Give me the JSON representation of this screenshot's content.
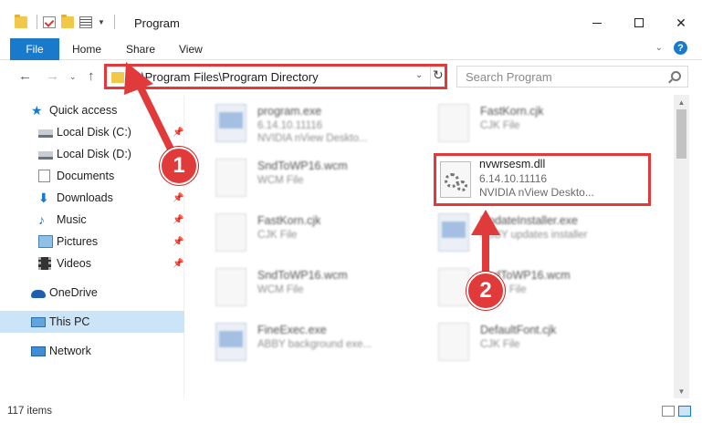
{
  "window": {
    "title": "Program"
  },
  "ribbon": {
    "tabs": [
      "File",
      "Home",
      "Share",
      "View"
    ]
  },
  "address": {
    "path": "C:\\Program Files\\Program Directory"
  },
  "search": {
    "placeholder": "Search Program"
  },
  "sidebar": {
    "items": [
      {
        "label": "Quick access",
        "icon": "star-icon"
      },
      {
        "label": "Local Disk (C:)",
        "icon": "drive-icon",
        "pinned": true
      },
      {
        "label": "Local Disk (D:)",
        "icon": "drive-icon"
      },
      {
        "label": "Documents",
        "icon": "documents-icon",
        "pinned": true
      },
      {
        "label": "Downloads",
        "icon": "download-icon",
        "pinned": true
      },
      {
        "label": "Music",
        "icon": "music-icon",
        "pinned": true
      },
      {
        "label": "Pictures",
        "icon": "pictures-icon",
        "pinned": true
      },
      {
        "label": "Videos",
        "icon": "videos-icon",
        "pinned": true
      },
      {
        "label": "OneDrive",
        "icon": "onedrive-icon"
      },
      {
        "label": "This PC",
        "icon": "pc-icon",
        "selected": true
      },
      {
        "label": "Network",
        "icon": "network-icon"
      }
    ]
  },
  "files": [
    {
      "name": "program.exe",
      "line2": "6.14.10.11116",
      "line3": "NVIDIA nView Deskto...",
      "icon": "exe"
    },
    {
      "name": "FastKorn.cjk",
      "line2": "CJK File",
      "line3": "",
      "icon": "file"
    },
    {
      "name": "SndToWP16.wcm",
      "line2": "WCM File",
      "line3": "",
      "icon": "file"
    },
    {
      "name": "FastKorn.cjk",
      "line2": "CJK File",
      "line3": "",
      "icon": "file"
    },
    {
      "name": "UpdateInstaller.exe",
      "line2": "ABBY updates installer",
      "line3": "",
      "icon": "exe"
    },
    {
      "name": "SndToWP16.wcm",
      "line2": "WCM File",
      "line3": "",
      "icon": "file"
    },
    {
      "name": "SndToWP16.wcm",
      "line2": "WCM File",
      "line3": "",
      "icon": "file"
    },
    {
      "name": "FineExec.exe",
      "line2": "ABBY background exe...",
      "line3": "",
      "icon": "exe"
    },
    {
      "name": "DefaultFont.cjk",
      "line2": "CJK File",
      "line3": "",
      "icon": "file"
    }
  ],
  "highlighted_file": {
    "name": "nvwrsesm.dll",
    "version": "6.14.10.11116",
    "description": "NVIDIA nView Deskto..."
  },
  "status": {
    "item_count": "117 items"
  },
  "annotations": {
    "badge1": "1",
    "badge2": "2",
    "color": "#e03a3a"
  },
  "colors": {
    "accent": "#1979ca",
    "selected_bg": "#cce4f7"
  }
}
